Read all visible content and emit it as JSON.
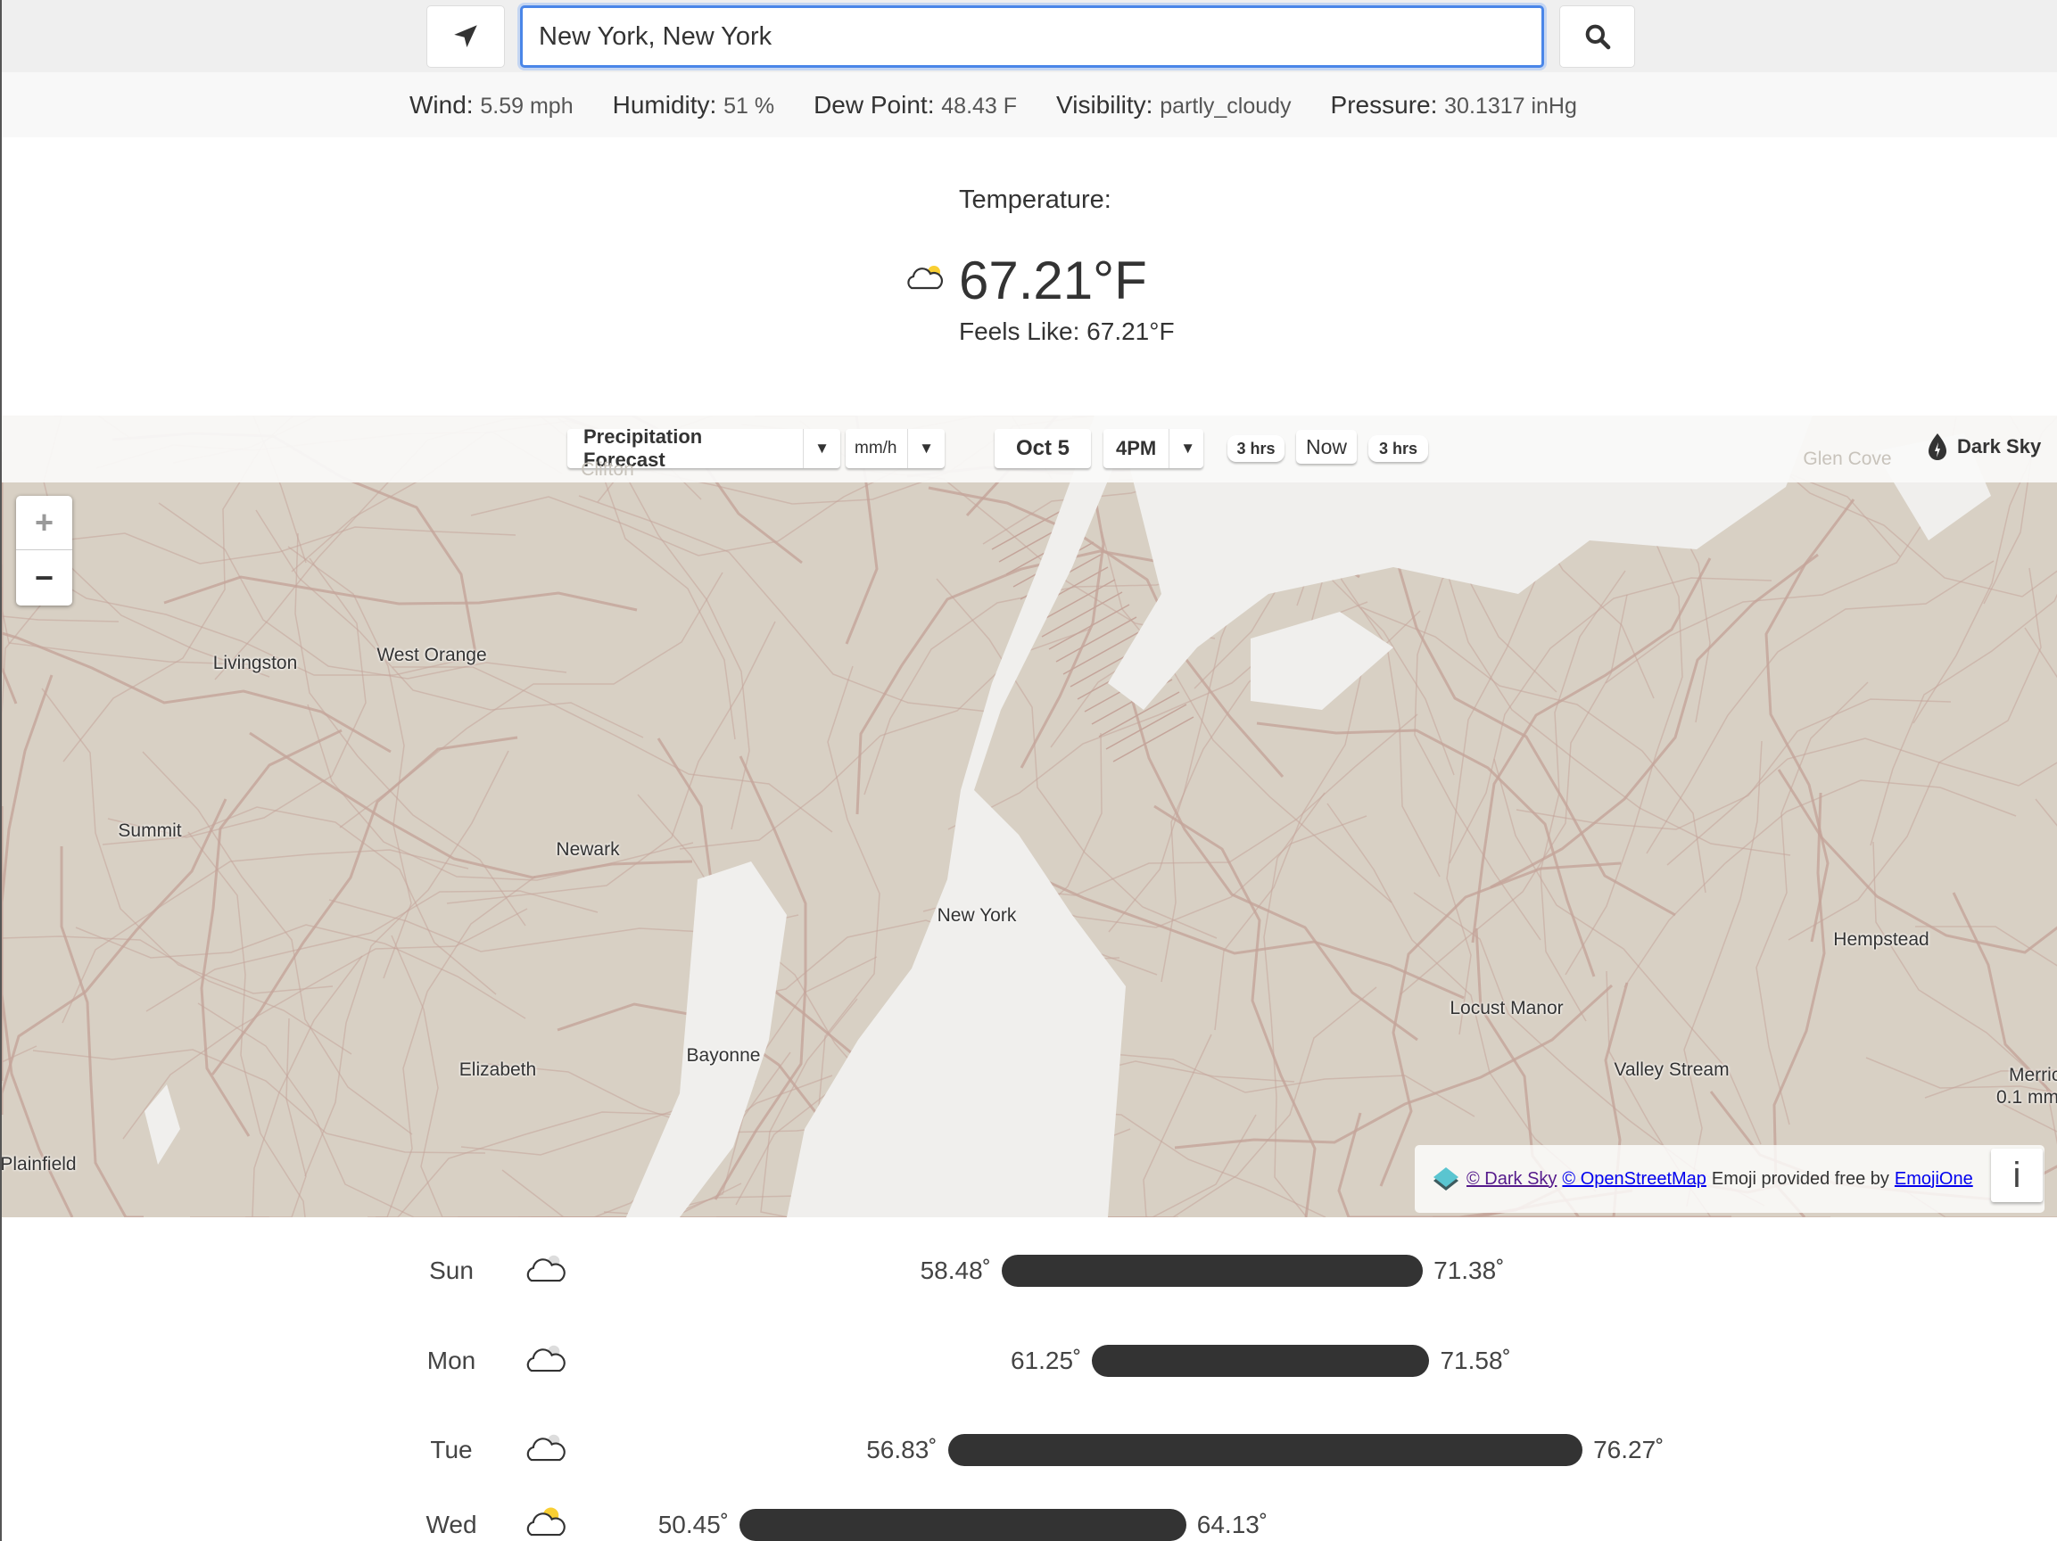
{
  "search": {
    "value": "New York, New York",
    "location_icon": "location-arrow-icon",
    "search_icon": "search-icon"
  },
  "stats": [
    {
      "label": "Wind:",
      "value": "5.59 mph"
    },
    {
      "label": "Humidity:",
      "value": "51 %"
    },
    {
      "label": "Dew Point:",
      "value": "48.43 F"
    },
    {
      "label": "Visibility:",
      "value": "partly_cloudy"
    },
    {
      "label": "Pressure:",
      "value": "30.1317 inHg"
    }
  ],
  "current": {
    "label": "Temperature:",
    "temp": "67.21°F",
    "feels": "Feels Like: 67.21°F",
    "icon": "cloud-icon"
  },
  "map": {
    "toolbar": {
      "layer": "Precipitation Forecast",
      "unit": "mm/h",
      "date": "Oct 5",
      "time": "4PM",
      "back": "3 hrs",
      "now": "Now",
      "forward": "3 hrs",
      "brand": "Dark Sky",
      "caret": "▼"
    },
    "zoom_in": "+",
    "zoom_out": "−",
    "labels": [
      {
        "text": "Livingston"
      },
      {
        "text": "West Orange"
      },
      {
        "text": "Summit"
      },
      {
        "text": "Newark"
      },
      {
        "text": "New York"
      },
      {
        "text": "Bayonne"
      },
      {
        "text": "Elizabeth"
      },
      {
        "text": "Plainfield"
      },
      {
        "text": "Locust Manor"
      },
      {
        "text": "Hempstead"
      },
      {
        "text": "Valley Stream"
      },
      {
        "text": "Merric"
      },
      {
        "text": "0.1 mm"
      },
      {
        "text": "Glen Cove"
      },
      {
        "text": "Clifton"
      }
    ],
    "attribution": {
      "darksky": "© Dark Sky",
      "osm": "© OpenStreetMap",
      "emoji_text": "Emoji provided free by",
      "emojione": "EmojiOne",
      "info": "i"
    }
  },
  "forecast": [
    {
      "day": "Sun",
      "low": 58.48,
      "high": 71.38,
      "low_text": "58.48˚",
      "high_text": "71.38˚",
      "icon": "cloud"
    },
    {
      "day": "Mon",
      "low": 61.25,
      "high": 71.58,
      "low_text": "61.25˚",
      "high_text": "71.58˚",
      "icon": "cloud"
    },
    {
      "day": "Tue",
      "low": 56.83,
      "high": 76.27,
      "low_text": "56.83˚",
      "high_text": "76.27˚",
      "icon": "cloud"
    },
    {
      "day": "Wed",
      "low": 50.45,
      "high": 64.13,
      "low_text": "50.45˚",
      "high_text": "64.13˚",
      "icon": "partly-sunny"
    }
  ],
  "colors": {
    "accent": "#4a86e8",
    "bar": "#333333",
    "map_land": "#d8d0c4",
    "map_road": "#c4a49a",
    "sun": "#f9cf33"
  }
}
